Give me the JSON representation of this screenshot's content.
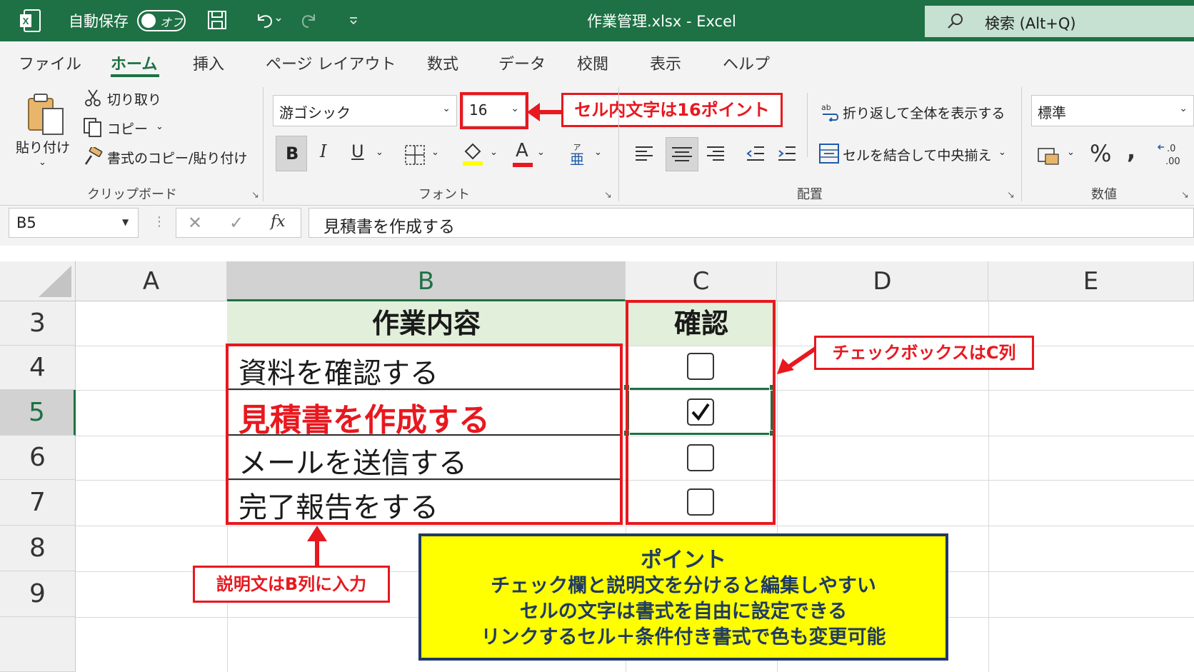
{
  "titlebar": {
    "autosave_label": "自動保存",
    "autosave_state": "オフ",
    "file_title": "作業管理.xlsx  -  Excel",
    "search_label": "検索 (Alt+Q)"
  },
  "tabs": [
    "ファイル",
    "ホーム",
    "挿入",
    "ページ レイアウト",
    "数式",
    "データ",
    "校閲",
    "表示",
    "ヘルプ"
  ],
  "active_tab": "ホーム",
  "clipboard": {
    "paste": "貼り付け",
    "cut": "切り取り",
    "copy": "コピー",
    "format_painter": "書式のコピー/貼り付け",
    "group": "クリップボード"
  },
  "font": {
    "name": "游ゴシック",
    "size": "16",
    "bold": "B",
    "italic": "I",
    "underline": "U",
    "font_color_glyph": "A",
    "group": "フォント"
  },
  "alignment": {
    "wrap": "折り返して全体を表示する",
    "merge": "セルを結合して中央揃え",
    "group": "配置"
  },
  "number": {
    "format": "標準",
    "percent": "%",
    "comma": ",",
    "group": "数値"
  },
  "formula_bar": {
    "name_box": "B5",
    "fx": "fx",
    "content": "見積書を作成する"
  },
  "columns": [
    "A",
    "B",
    "C",
    "D",
    "E"
  ],
  "selected_column": "B",
  "rows": [
    "3",
    "4",
    "5",
    "6",
    "7",
    "8",
    "9"
  ],
  "selected_row": "5",
  "table": {
    "header_task": "作業内容",
    "header_check": "確認",
    "tasks": [
      {
        "text": "資料を確認する",
        "checked": false
      },
      {
        "text": "見積書を作成する",
        "checked": true
      },
      {
        "text": "メールを送信する",
        "checked": false
      },
      {
        "text": "完了報告をする",
        "checked": false
      }
    ]
  },
  "annotations": {
    "font_size": "セル内文字は16ポイント",
    "checkbox_column": "チェックボックスはC列",
    "description_column": "説明文はB列に入力"
  },
  "point_box": {
    "title": "ポイント",
    "lines": [
      "チェック欄と説明文を分けると編集しやすい",
      "セルの文字は書式を自由に設定できる",
      "リンクするセル＋条件付き書式で色も変更可能"
    ]
  },
  "colors": {
    "excel_green": "#1e7145",
    "callout_red": "#e8181f",
    "header_fill": "#e2efda",
    "point_fill": "#ffff00",
    "point_border": "#1f3b64"
  }
}
